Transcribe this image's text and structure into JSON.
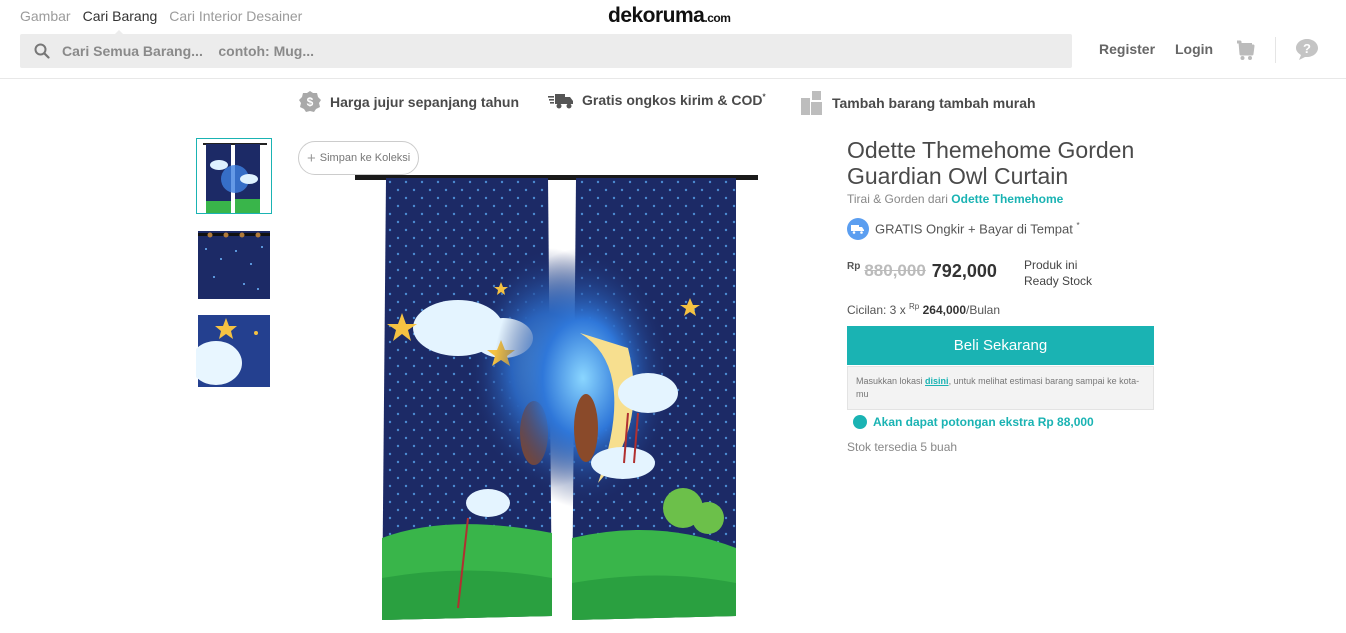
{
  "header": {
    "tabs": [
      "Gambar",
      "Cari Barang",
      "Cari Interior Desainer"
    ],
    "logo_main": "dekoruma",
    "logo_suffix": ".com",
    "search_placeholder": "Cari Semua Barang...    contoh: Mug...",
    "register": "Register",
    "login": "Login"
  },
  "usp": {
    "item1": "Harga jujur sepanjang tahun",
    "item2": "Gratis ongkos kirim & COD",
    "item2_sup": "*",
    "item3": "Tambah barang tambah murah"
  },
  "gallery": {
    "save_label": "Simpan ke Koleksi",
    "save_plus": "+"
  },
  "product": {
    "title": "Odette Themehome Gorden Guardian Owl Curtain",
    "category_prefix": "Tirai & Gorden dari",
    "brand": "Odette Themehome",
    "ongkir_text": "GRATIS Ongkir + Bayar di Tempat",
    "ongkir_sup": "*",
    "currency": "Rp",
    "old_price": "880,000",
    "new_price": "792,000",
    "stock_note_1": "Produk ini",
    "stock_note_2": "Ready Stock",
    "cicilan_prefix": "Cicilan: 3 x",
    "cicilan_currency": "Rp",
    "cicilan_amount": "264,000",
    "cicilan_suffix": "/Bulan",
    "buy_button": "Beli Sekarang",
    "location_text_1": "Masukkan lokasi",
    "location_link": "disini",
    "location_text_2": ", untuk melihat estimasi barang sampai ke kota-mu",
    "extra_discount": "Akan dapat potongan ekstra Rp 88,000",
    "stock_available": "Stok tersedia 5 buah"
  },
  "colors": {
    "accent": "#1ab3b3",
    "curtain_dark": "#1c2a66",
    "grass": "#39b54a"
  }
}
